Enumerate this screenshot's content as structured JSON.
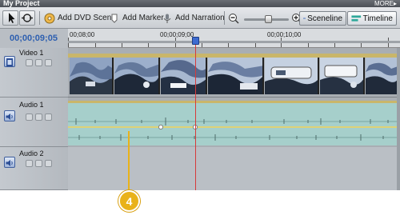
{
  "window": {
    "title": "My Project",
    "more_label": "MORE▸"
  },
  "toolbar": {
    "add_dvd_scene": "Add DVD Scene",
    "add_marker": "Add Marker",
    "add_narration": "Add Narration",
    "sceneline": "Sceneline",
    "timeline": "Timeline",
    "active_view": "Timeline"
  },
  "timeline": {
    "current_time": "00;00;09;05",
    "ruler_labels": [
      "00;08;00",
      "00;00;09;00",
      "00;00;10;00"
    ]
  },
  "tracks": {
    "video_label": "Video 1",
    "audio1_label": "Audio 1",
    "audio2_label": "Audio 2"
  },
  "callout": {
    "number": "4"
  },
  "colors": {
    "playhead": "#d63a3a",
    "callout": "#e9b21a",
    "timecode": "#2d5fb0",
    "audio_bg": "#a6cfcb"
  }
}
